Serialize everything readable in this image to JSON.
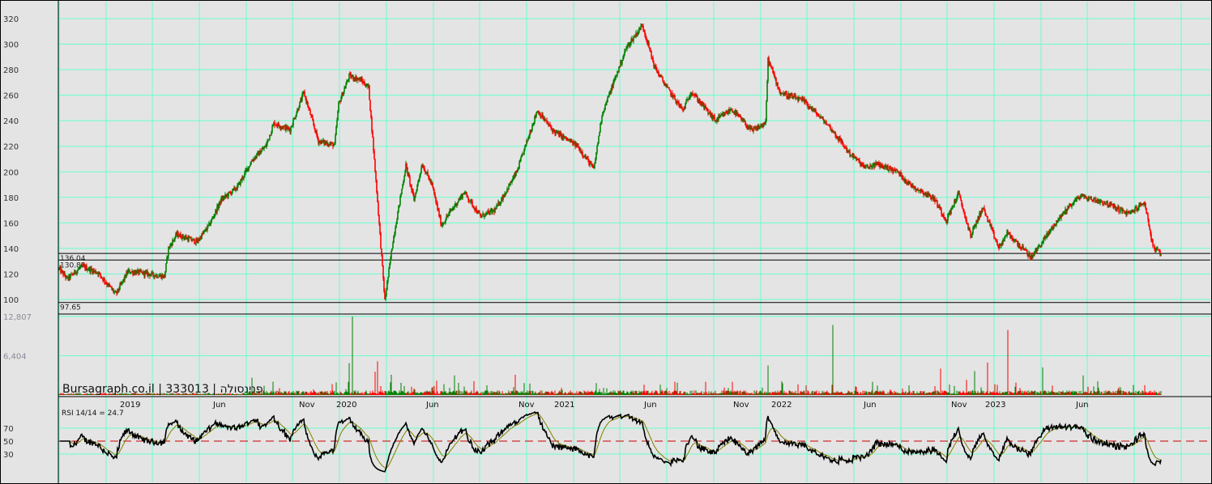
{
  "watermark": "Bursagraph.co.il | 333013 | פנינסולה",
  "colors": {
    "background": "#e4e4e4",
    "grid": "#66ffcc",
    "up": "#008000",
    "down": "#ff0000",
    "level_line": "#000000",
    "rsi_line": "#000000",
    "rsi_signal": "#808000",
    "rsi_midline": "#cc0000"
  },
  "chart_data": [
    {
      "type": "candlestick",
      "panel": "price",
      "y_ticks": [
        "320",
        "300",
        "280",
        "260",
        "240",
        "220",
        "200",
        "180",
        "160",
        "140",
        "120",
        "100"
      ],
      "ylim": [
        96,
        326
      ],
      "horizontal_levels": [
        {
          "label": "136.04",
          "value": 136.04
        },
        {
          "label": "130.88",
          "value": 130.88
        },
        {
          "label": "97.65",
          "value": 97.65
        }
      ],
      "x_labels": [
        "2019",
        "Jun",
        "Nov",
        "2020",
        "Jun",
        "Nov",
        "2021",
        "Jun",
        "Nov",
        "2022",
        "Jun",
        "Nov",
        "2023",
        "Jun"
      ],
      "price_path": [
        [
          0,
          124
        ],
        [
          10,
          116
        ],
        [
          28,
          126
        ],
        [
          48,
          121
        ],
        [
          70,
          104
        ],
        [
          85,
          122
        ],
        [
          100,
          121
        ],
        [
          130,
          118
        ],
        [
          135,
          140
        ],
        [
          145,
          151
        ],
        [
          170,
          145
        ],
        [
          185,
          158
        ],
        [
          200,
          178
        ],
        [
          220,
          188
        ],
        [
          238,
          209
        ],
        [
          255,
          220
        ],
        [
          265,
          238
        ],
        [
          285,
          233
        ],
        [
          302,
          262
        ],
        [
          320,
          224
        ],
        [
          340,
          221
        ],
        [
          345,
          253
        ],
        [
          358,
          275
        ],
        [
          372,
          272
        ],
        [
          382,
          266
        ],
        [
          392,
          185
        ],
        [
          402,
          99
        ],
        [
          412,
          146
        ],
        [
          428,
          205
        ],
        [
          438,
          178
        ],
        [
          448,
          206
        ],
        [
          460,
          190
        ],
        [
          472,
          158
        ],
        [
          482,
          168
        ],
        [
          500,
          184
        ],
        [
          520,
          165
        ],
        [
          538,
          170
        ],
        [
          550,
          183
        ],
        [
          565,
          200
        ],
        [
          590,
          248
        ],
        [
          610,
          232
        ],
        [
          640,
          220
        ],
        [
          660,
          202
        ],
        [
          670,
          245
        ],
        [
          700,
          297
        ],
        [
          720,
          315
        ],
        [
          735,
          282
        ],
        [
          750,
          266
        ],
        [
          770,
          248
        ],
        [
          780,
          263
        ],
        [
          810,
          240
        ],
        [
          830,
          249
        ],
        [
          855,
          232
        ],
        [
          872,
          238
        ],
        [
          875,
          288
        ],
        [
          890,
          262
        ],
        [
          920,
          255
        ],
        [
          950,
          236
        ],
        [
          975,
          215
        ],
        [
          995,
          203
        ],
        [
          1010,
          206
        ],
        [
          1035,
          200
        ],
        [
          1050,
          190
        ],
        [
          1080,
          179
        ],
        [
          1095,
          162
        ],
        [
          1110,
          183
        ],
        [
          1125,
          150
        ],
        [
          1140,
          172
        ],
        [
          1160,
          140
        ],
        [
          1170,
          152
        ],
        [
          1200,
          133
        ],
        [
          1230,
          160
        ],
        [
          1245,
          172
        ],
        [
          1260,
          181
        ],
        [
          1290,
          176
        ],
        [
          1320,
          167
        ],
        [
          1340,
          176
        ],
        [
          1350,
          141
        ],
        [
          1360,
          135
        ]
      ]
    },
    {
      "type": "bar",
      "panel": "volume",
      "y_ticks": [
        "12,807",
        "6,404"
      ],
      "ylim": [
        0,
        12807
      ],
      "spikes": [
        {
          "x": 238,
          "value": 2800
        },
        {
          "x": 362,
          "value": 12807
        },
        {
          "x": 358,
          "value": 5200
        },
        {
          "x": 393,
          "value": 5500
        },
        {
          "x": 390,
          "value": 3800
        },
        {
          "x": 410,
          "value": 3300
        },
        {
          "x": 488,
          "value": 3200
        },
        {
          "x": 563,
          "value": 3300
        },
        {
          "x": 875,
          "value": 4800
        },
        {
          "x": 955,
          "value": 11400
        },
        {
          "x": 1088,
          "value": 4300
        },
        {
          "x": 1146,
          "value": 5300
        },
        {
          "x": 1171,
          "value": 10600
        },
        {
          "x": 1214,
          "value": 4500
        },
        {
          "x": 1264,
          "value": 3200
        },
        {
          "x": 1130,
          "value": 3900
        }
      ]
    },
    {
      "type": "line",
      "panel": "rsi",
      "label": "RSI 14/14 = 24.7",
      "y_ticks": [
        "70",
        "50",
        "30"
      ],
      "ylim": [
        0,
        100
      ],
      "midline": 50
    }
  ]
}
